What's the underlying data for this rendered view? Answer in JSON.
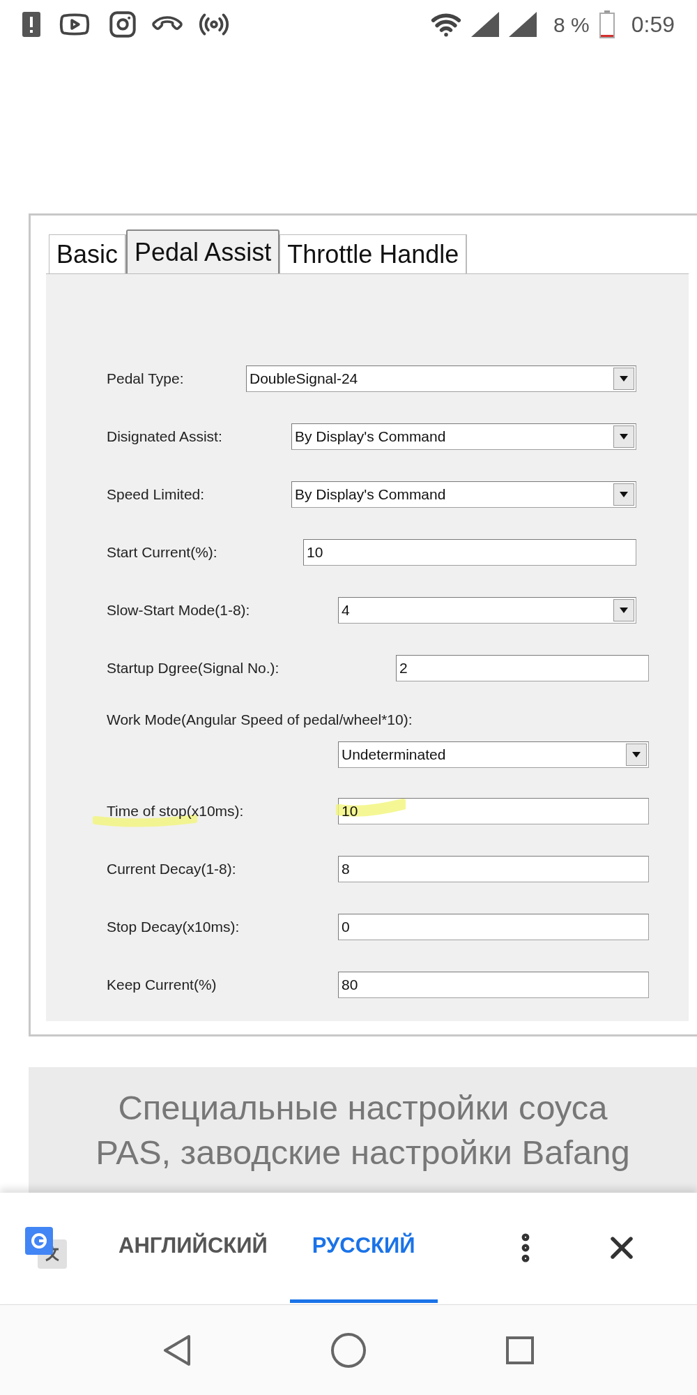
{
  "status_bar": {
    "battery": "8 %",
    "time": "0:59"
  },
  "dialog": {
    "tabs": [
      {
        "label": "Basic",
        "selected": false
      },
      {
        "label": "Pedal Assist",
        "selected": true
      },
      {
        "label": "Throttle Handle",
        "selected": false
      }
    ],
    "fields": [
      {
        "kind": "dropdown",
        "label": "Pedal Type:",
        "value": "DoubleSignal-24",
        "highlighted": false
      },
      {
        "kind": "dropdown",
        "label": "Disignated Assist:",
        "value": "By Display's Command",
        "highlighted": false
      },
      {
        "kind": "dropdown",
        "label": "Speed Limited:",
        "value": "By Display's Command",
        "highlighted": false
      },
      {
        "kind": "text",
        "label": "Start Current(%):",
        "value": "10",
        "highlighted": false
      },
      {
        "kind": "dropdown",
        "label": "Slow-Start Mode(1-8):",
        "value": "4",
        "highlighted": false
      },
      {
        "kind": "text",
        "label": "Startup Dgree(Signal No.):",
        "value": "2",
        "highlighted": false
      },
      {
        "kind": "dropdown",
        "label": "Work Mode(Angular Speed of pedal/wheel*10):",
        "value": "Undeterminated",
        "highlighted": false
      },
      {
        "kind": "text",
        "label": "Time of stop(x10ms):",
        "value": "10",
        "highlighted": true
      },
      {
        "kind": "text",
        "label": "Current Decay(1-8):",
        "value": "8",
        "highlighted": false
      },
      {
        "kind": "text",
        "label": "Stop Decay(x10ms):",
        "value": "0",
        "highlighted": false
      },
      {
        "kind": "text",
        "label": "Keep Current(%)",
        "value": "80",
        "highlighted": false
      }
    ]
  },
  "caption": [
    "Специальные настройки соуса",
    "PAS, заводские настройки Bafang"
  ],
  "translate_bar": {
    "languages": [
      {
        "label": "АНГЛИЙСКИЙ",
        "selected": false
      },
      {
        "label": "РУССКИЙ",
        "selected": true
      }
    ]
  }
}
